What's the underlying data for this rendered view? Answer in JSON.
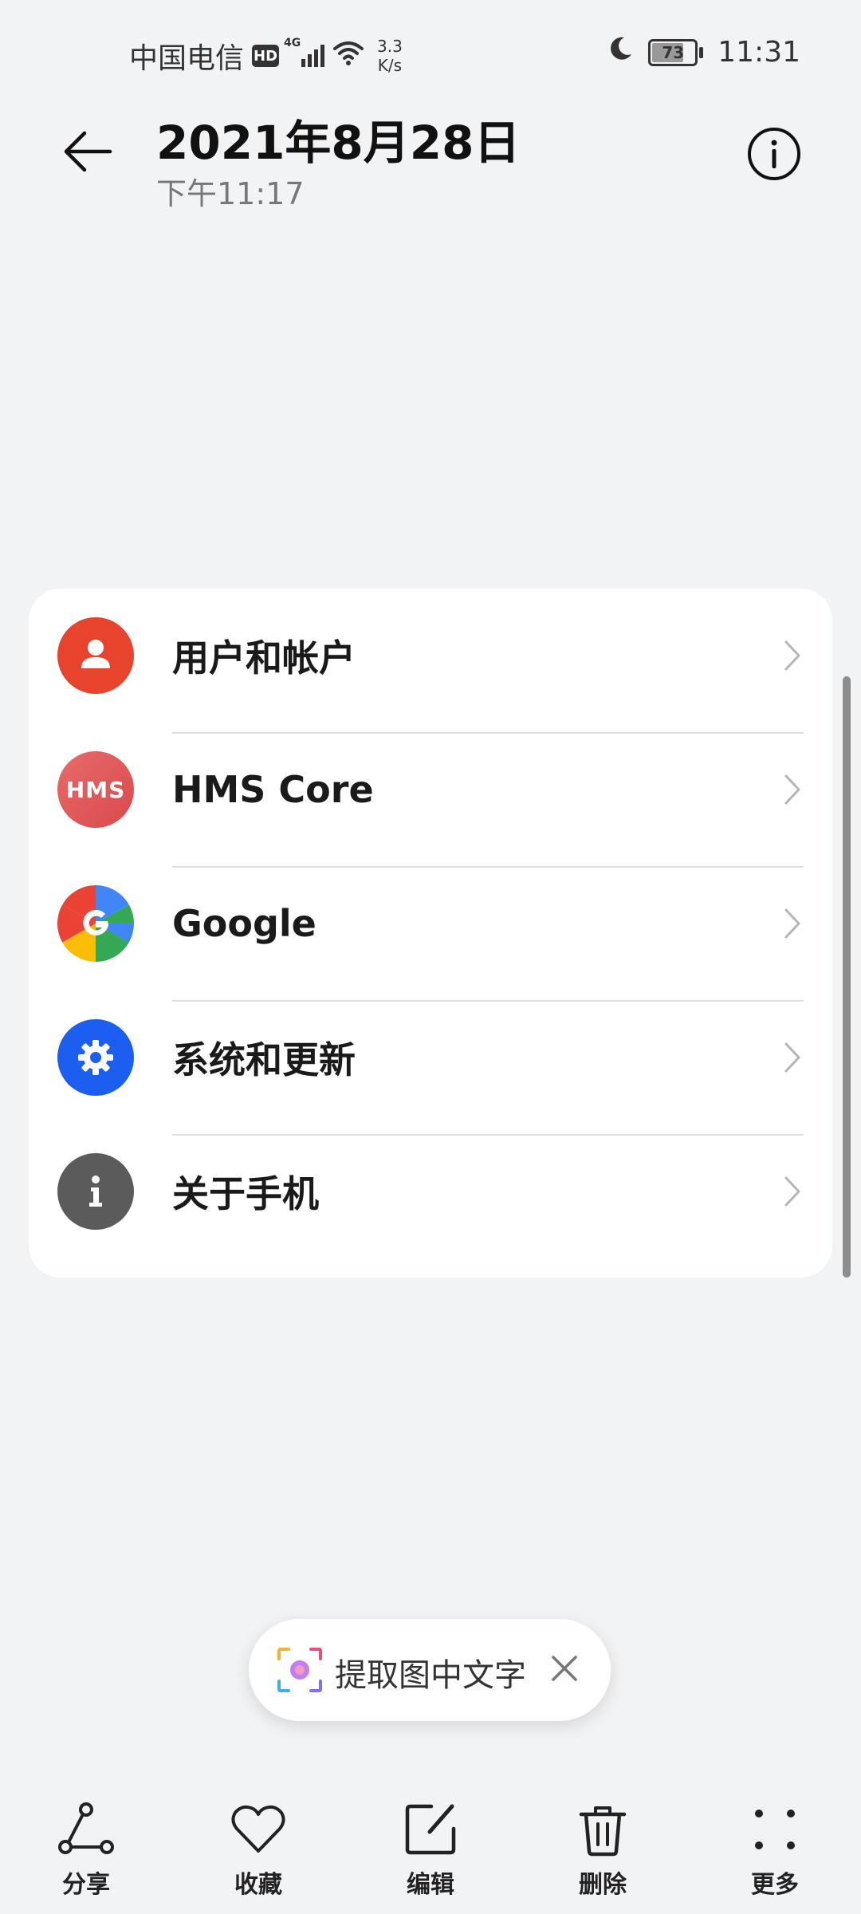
{
  "status_bar": {
    "carrier": "中国电信",
    "hd": "HD",
    "network": "4G",
    "speed_value": "3.3",
    "speed_unit": "K/s",
    "battery": "73",
    "time": "11:31"
  },
  "header": {
    "title": "2021年8月28日",
    "subtitle": "下午11:17"
  },
  "settings_list": {
    "items": [
      {
        "label": "用户和帐户",
        "icon": "user-icon"
      },
      {
        "label": "HMS Core",
        "icon": "hms-core-icon",
        "icon_text": "HMS"
      },
      {
        "label": "Google",
        "icon": "google-icon"
      },
      {
        "label": "系统和更新",
        "icon": "gear-icon"
      },
      {
        "label": "关于手机",
        "icon": "info-icon"
      }
    ]
  },
  "extract_text_pill": {
    "label": "提取图中文字"
  },
  "toolbar": {
    "share": "分享",
    "favorite": "收藏",
    "edit": "编辑",
    "delete": "删除",
    "more": "更多"
  },
  "colors": {
    "background": "#f1f3f5",
    "user_icon": "#e8432d",
    "hms_icon": "#e05a5a",
    "system_icon": "#1b5ef0",
    "about_icon": "#5b5b5b"
  }
}
